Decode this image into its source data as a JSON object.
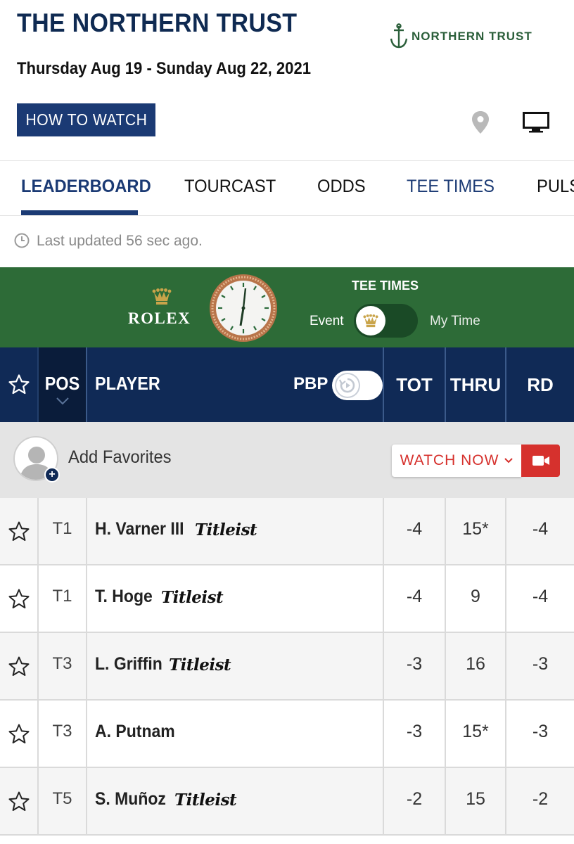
{
  "header": {
    "title": "THE NORTHERN TRUST",
    "dates": "Thursday Aug 19 - Sunday Aug 22, 2021",
    "how_to_watch": "HOW TO WATCH",
    "brand_logo_text": "NORTHERN TRUST",
    "location_icon": "map-pin-icon",
    "tv_icon": "tv-icon"
  },
  "tabs": [
    {
      "label": "LEADERBOARD",
      "state": "active"
    },
    {
      "label": "TOURCAST",
      "state": "normal"
    },
    {
      "label": "ODDS",
      "state": "normal"
    },
    {
      "label": "TEE TIMES",
      "state": "highlight"
    },
    {
      "label": "PULS",
      "state": "normal"
    }
  ],
  "updated": {
    "text": "Last updated 56 sec ago.",
    "icon": "clock-icon"
  },
  "sponsor": {
    "brand": "ROLEX",
    "tee_times_label": "TEE TIMES",
    "toggle_left": "Event",
    "toggle_right": "My Time",
    "toggle_selected": "Event"
  },
  "columns": {
    "pos": "POS",
    "player": "PLAYER",
    "pbp": "PBP",
    "tot": "TOT",
    "thru": "THRU",
    "rd": "RD"
  },
  "favorites": {
    "label": "Add Favorites",
    "watch_now": "WATCH NOW"
  },
  "colors": {
    "navy": "#102a56",
    "brand_blue": "#1b3a74",
    "rolex_green": "#2d6b37",
    "watch_red": "#d6312d"
  },
  "players": [
    {
      "pos": "T1",
      "name": "H. Varner III",
      "ball": "Titleist",
      "tot": "-4",
      "thru": "15*",
      "rd": "-4"
    },
    {
      "pos": "T1",
      "name": "T. Hoge",
      "ball": "Titleist",
      "tot": "-4",
      "thru": "9",
      "rd": "-4"
    },
    {
      "pos": "T3",
      "name": "L. Griffin",
      "ball": "Titleist",
      "tot": "-3",
      "thru": "16",
      "rd": "-3"
    },
    {
      "pos": "T3",
      "name": "A. Putnam",
      "ball": "",
      "tot": "-3",
      "thru": "15*",
      "rd": "-3"
    },
    {
      "pos": "T5",
      "name": "S. Muñoz",
      "ball": "Titleist",
      "tot": "-2",
      "thru": "15",
      "rd": "-2"
    }
  ]
}
